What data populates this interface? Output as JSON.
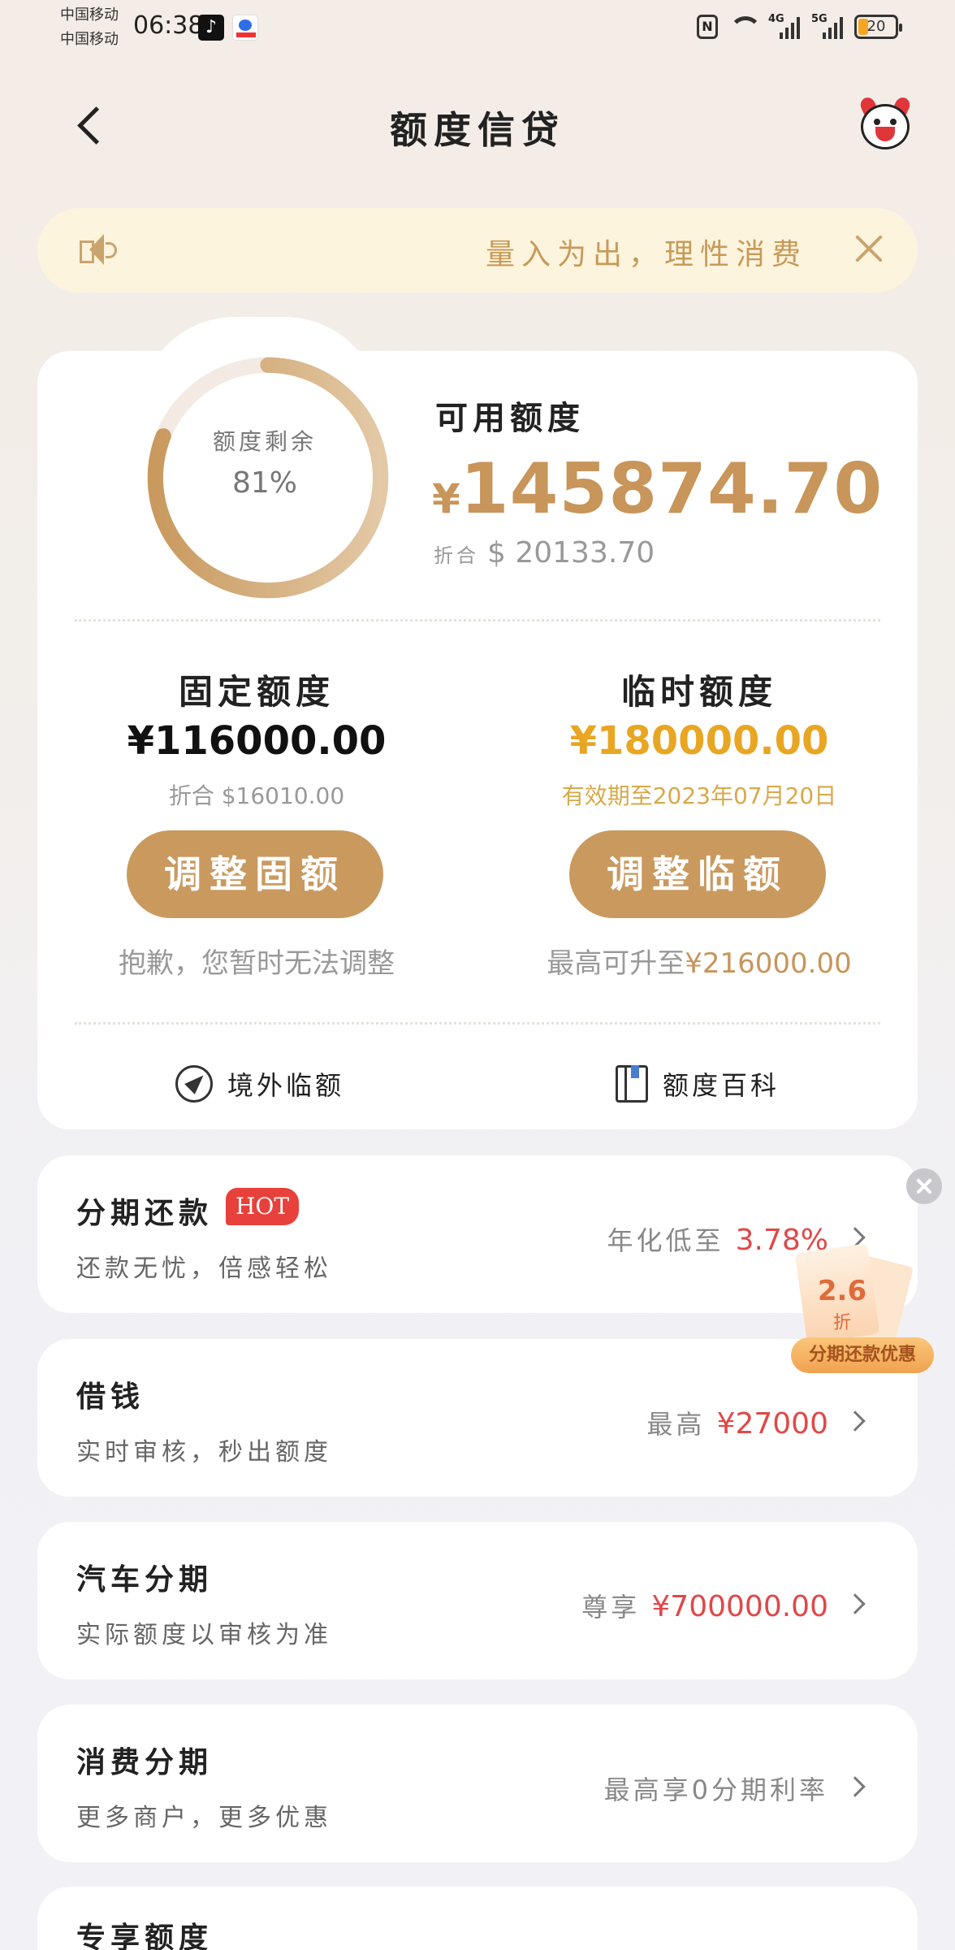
{
  "status_bar": {
    "carrier1": "中国移动",
    "carrier2": "中国移动",
    "time": "06:38",
    "net1": "4G",
    "net2": "5G",
    "battery": "20"
  },
  "header": {
    "title": "额度信贷"
  },
  "notice": {
    "text": "量入为出，理性消费"
  },
  "credit": {
    "ring_label": "额度剩余",
    "ring_percent": "81%",
    "ring_fraction": 0.81,
    "available_label": "可用额度",
    "currency_symbol": "¥",
    "available_amount": "145874.70",
    "usd_prefix": "折合",
    "usd_amount": "$ 20133.70"
  },
  "fixed": {
    "title": "固定额度",
    "amount": "¥116000.00",
    "usd": "折合 $16010.00",
    "button": "调整固额",
    "note": "抱歉，您暂时无法调整"
  },
  "temp": {
    "title": "临时额度",
    "amount": "¥180000.00",
    "validity": "有效期至2023年07月20日",
    "button": "调整临额",
    "note_prefix": "最高可升至",
    "note_value": "¥216000.00"
  },
  "links": {
    "overseas": "境外临额",
    "wiki": "额度百科"
  },
  "products": [
    {
      "title": "分期还款",
      "badge": "HOT",
      "desc": "还款无忧，倍感轻松",
      "right_prefix": "年化低至 ",
      "right_value": "3.78%"
    },
    {
      "title": "借钱",
      "desc": "实时审核，秒出额度",
      "right_prefix": "最高 ",
      "right_value": "¥27000"
    },
    {
      "title": "汽车分期",
      "desc": "实际额度以审核为准",
      "right_prefix": "尊享 ",
      "right_value": "¥700000.00"
    },
    {
      "title": "消费分期",
      "desc": "更多商户，更多优惠",
      "right_prefix": "最高享0分期利率",
      "right_value": ""
    },
    {
      "title": "专享额度"
    }
  ],
  "promo": {
    "discount": "2.6",
    "unit": "折",
    "label": "分期还款优惠"
  },
  "colors": {
    "gold": "#c9995e",
    "accent_amount": "#e8a623",
    "red": "#e04848",
    "notice_bg": "#fdf4de"
  }
}
